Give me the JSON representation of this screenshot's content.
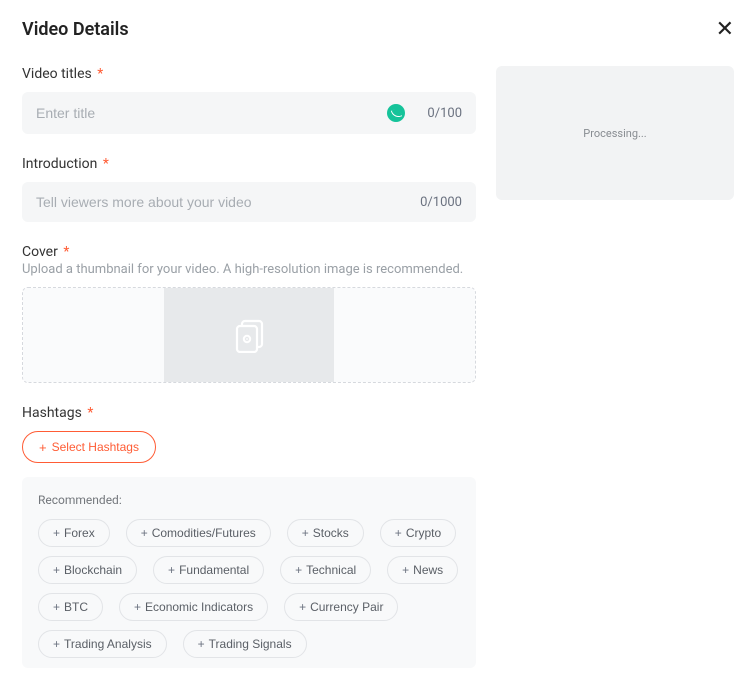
{
  "header": {
    "title": "Video Details"
  },
  "fields": {
    "title": {
      "label": "Video titles",
      "placeholder": "Enter title",
      "counter": "0/100"
    },
    "intro": {
      "label": "Introduction",
      "placeholder": "Tell viewers more about your video",
      "counter": "0/1000"
    },
    "cover": {
      "label": "Cover",
      "helper": "Upload a thumbnail for your video. A high-resolution image is recommended."
    },
    "hashtags": {
      "label": "Hashtags",
      "select_label": "Select Hashtags"
    }
  },
  "recommended": {
    "title": "Recommended:",
    "tags": [
      "Forex",
      "Comodities/Futures",
      "Stocks",
      "Crypto",
      "Blockchain",
      "Fundamental",
      "Technical",
      "News",
      "BTC",
      "Economic Indicators",
      "Currency Pair",
      "Trading Analysis",
      "Trading Signals"
    ]
  },
  "preview": {
    "status": "Processing..."
  },
  "symbols": {
    "required": "*",
    "close": "✕",
    "plus": "+"
  }
}
